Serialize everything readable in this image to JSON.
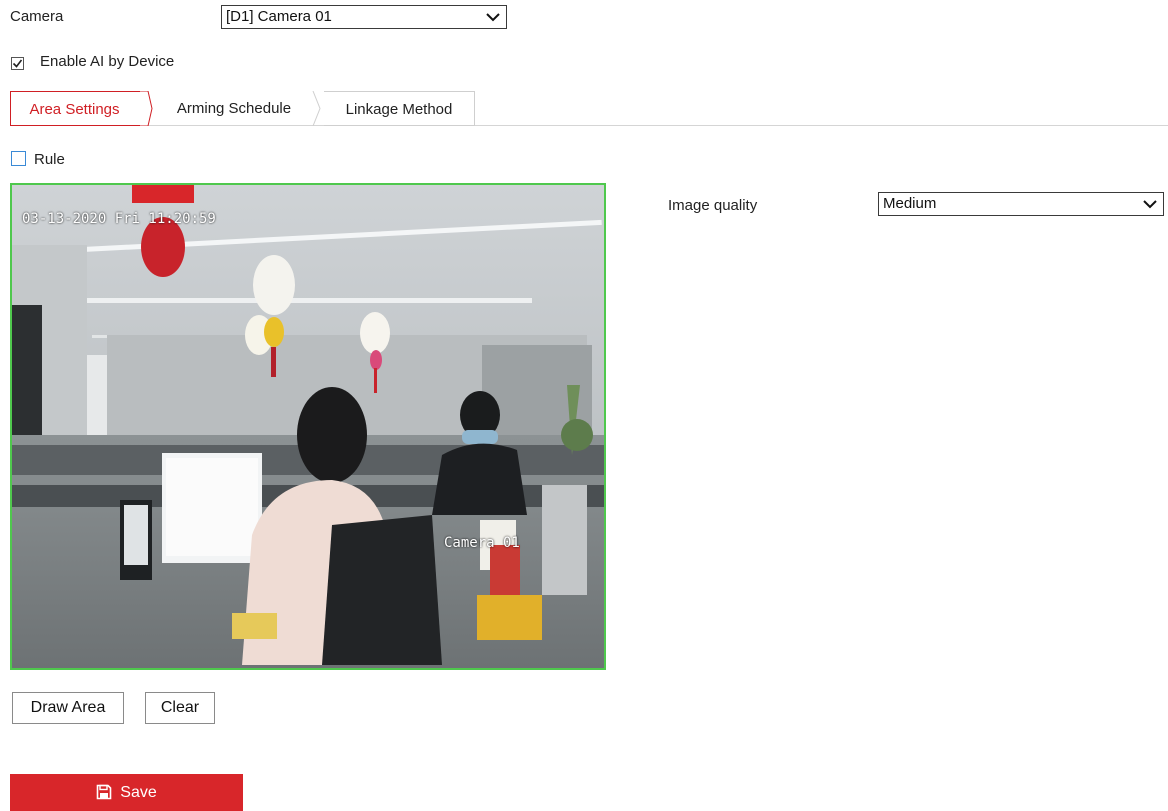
{
  "camera": {
    "label": "Camera",
    "selected": "[D1] Camera 01"
  },
  "enable_ai": {
    "label": "Enable AI by Device",
    "checked": true
  },
  "tabs": [
    {
      "label": "Area Settings",
      "active": true
    },
    {
      "label": "Arming Schedule",
      "active": false
    },
    {
      "label": "Linkage Method",
      "active": false
    }
  ],
  "rule": {
    "label": "Rule",
    "checked": false
  },
  "video": {
    "osd_timestamp": "03-13-2020 Fri 11:20:59",
    "osd_camera_name": "Camera 01"
  },
  "image_quality": {
    "label": "Image quality",
    "selected": "Medium"
  },
  "buttons": {
    "draw_area": "Draw Area",
    "clear": "Clear",
    "save": "Save"
  },
  "colors": {
    "accent": "#d8262a",
    "active_tab": "#d01f24",
    "rule_checkbox": "#3a8ad6",
    "video_border": "#4fc84d"
  },
  "icons": {
    "save": "floppy-disk-icon",
    "dropdown": "chevron-down-icon",
    "check": "check-icon"
  }
}
